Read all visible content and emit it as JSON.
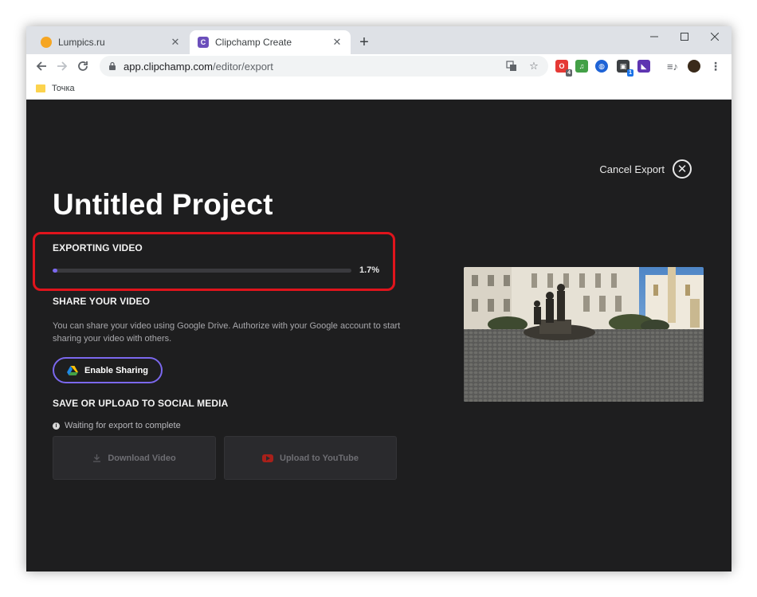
{
  "browser": {
    "tabs": [
      {
        "title": "Lumpics.ru",
        "active": false
      },
      {
        "title": "Clipchamp Create",
        "active": true
      }
    ],
    "address": {
      "host": "app.clipchamp.com",
      "path": "/editor/export"
    },
    "bookmarks": [
      {
        "label": "Точка"
      }
    ],
    "extensions": [
      {
        "name": "opera-ext-icon",
        "color": "#e53935",
        "badge": "4"
      },
      {
        "name": "music-ext-icon",
        "color": "#43a047",
        "badge": ""
      },
      {
        "name": "vpn-ext-icon",
        "color": "#1e63d6",
        "badge": ""
      },
      {
        "name": "box-ext-icon",
        "color": "#3c4043",
        "badge": "1"
      },
      {
        "name": "ad-ext-icon",
        "color": "#5e35b1",
        "badge": ""
      }
    ]
  },
  "app": {
    "cancel_export": "Cancel Export",
    "project_title": "Untitled Project",
    "export": {
      "heading": "EXPORTING VIDEO",
      "progress_percent": 1.7,
      "progress_label": "1.7%"
    },
    "share": {
      "heading": "SHARE YOUR VIDEO",
      "description": "You can share your video using Google Drive. Authorize with your Google account to start sharing your video with others.",
      "button_label": "Enable Sharing"
    },
    "social": {
      "heading": "SAVE OR UPLOAD TO SOCIAL MEDIA",
      "waiting": "Waiting for export to complete",
      "download_label": "Download Video",
      "youtube_label": "Upload to YouTube"
    }
  },
  "colors": {
    "accent": "#7b68ee",
    "highlight": "#e0141c",
    "background": "#1e1e1f"
  }
}
